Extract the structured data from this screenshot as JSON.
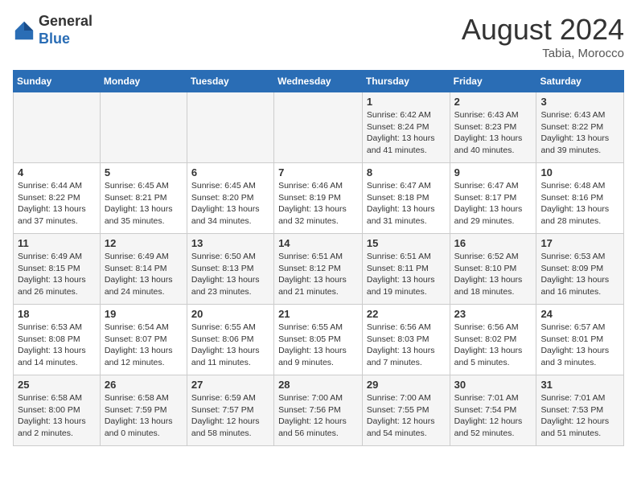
{
  "header": {
    "logo_line1": "General",
    "logo_line2": "Blue",
    "month_year": "August 2024",
    "location": "Tabia, Morocco"
  },
  "weekdays": [
    "Sunday",
    "Monday",
    "Tuesday",
    "Wednesday",
    "Thursday",
    "Friday",
    "Saturday"
  ],
  "weeks": [
    [
      {
        "day": "",
        "info": ""
      },
      {
        "day": "",
        "info": ""
      },
      {
        "day": "",
        "info": ""
      },
      {
        "day": "",
        "info": ""
      },
      {
        "day": "1",
        "info": "Sunrise: 6:42 AM\nSunset: 8:24 PM\nDaylight: 13 hours\nand 41 minutes."
      },
      {
        "day": "2",
        "info": "Sunrise: 6:43 AM\nSunset: 8:23 PM\nDaylight: 13 hours\nand 40 minutes."
      },
      {
        "day": "3",
        "info": "Sunrise: 6:43 AM\nSunset: 8:22 PM\nDaylight: 13 hours\nand 39 minutes."
      }
    ],
    [
      {
        "day": "4",
        "info": "Sunrise: 6:44 AM\nSunset: 8:22 PM\nDaylight: 13 hours\nand 37 minutes."
      },
      {
        "day": "5",
        "info": "Sunrise: 6:45 AM\nSunset: 8:21 PM\nDaylight: 13 hours\nand 35 minutes."
      },
      {
        "day": "6",
        "info": "Sunrise: 6:45 AM\nSunset: 8:20 PM\nDaylight: 13 hours\nand 34 minutes."
      },
      {
        "day": "7",
        "info": "Sunrise: 6:46 AM\nSunset: 8:19 PM\nDaylight: 13 hours\nand 32 minutes."
      },
      {
        "day": "8",
        "info": "Sunrise: 6:47 AM\nSunset: 8:18 PM\nDaylight: 13 hours\nand 31 minutes."
      },
      {
        "day": "9",
        "info": "Sunrise: 6:47 AM\nSunset: 8:17 PM\nDaylight: 13 hours\nand 29 minutes."
      },
      {
        "day": "10",
        "info": "Sunrise: 6:48 AM\nSunset: 8:16 PM\nDaylight: 13 hours\nand 28 minutes."
      }
    ],
    [
      {
        "day": "11",
        "info": "Sunrise: 6:49 AM\nSunset: 8:15 PM\nDaylight: 13 hours\nand 26 minutes."
      },
      {
        "day": "12",
        "info": "Sunrise: 6:49 AM\nSunset: 8:14 PM\nDaylight: 13 hours\nand 24 minutes."
      },
      {
        "day": "13",
        "info": "Sunrise: 6:50 AM\nSunset: 8:13 PM\nDaylight: 13 hours\nand 23 minutes."
      },
      {
        "day": "14",
        "info": "Sunrise: 6:51 AM\nSunset: 8:12 PM\nDaylight: 13 hours\nand 21 minutes."
      },
      {
        "day": "15",
        "info": "Sunrise: 6:51 AM\nSunset: 8:11 PM\nDaylight: 13 hours\nand 19 minutes."
      },
      {
        "day": "16",
        "info": "Sunrise: 6:52 AM\nSunset: 8:10 PM\nDaylight: 13 hours\nand 18 minutes."
      },
      {
        "day": "17",
        "info": "Sunrise: 6:53 AM\nSunset: 8:09 PM\nDaylight: 13 hours\nand 16 minutes."
      }
    ],
    [
      {
        "day": "18",
        "info": "Sunrise: 6:53 AM\nSunset: 8:08 PM\nDaylight: 13 hours\nand 14 minutes."
      },
      {
        "day": "19",
        "info": "Sunrise: 6:54 AM\nSunset: 8:07 PM\nDaylight: 13 hours\nand 12 minutes."
      },
      {
        "day": "20",
        "info": "Sunrise: 6:55 AM\nSunset: 8:06 PM\nDaylight: 13 hours\nand 11 minutes."
      },
      {
        "day": "21",
        "info": "Sunrise: 6:55 AM\nSunset: 8:05 PM\nDaylight: 13 hours\nand 9 minutes."
      },
      {
        "day": "22",
        "info": "Sunrise: 6:56 AM\nSunset: 8:03 PM\nDaylight: 13 hours\nand 7 minutes."
      },
      {
        "day": "23",
        "info": "Sunrise: 6:56 AM\nSunset: 8:02 PM\nDaylight: 13 hours\nand 5 minutes."
      },
      {
        "day": "24",
        "info": "Sunrise: 6:57 AM\nSunset: 8:01 PM\nDaylight: 13 hours\nand 3 minutes."
      }
    ],
    [
      {
        "day": "25",
        "info": "Sunrise: 6:58 AM\nSunset: 8:00 PM\nDaylight: 13 hours\nand 2 minutes."
      },
      {
        "day": "26",
        "info": "Sunrise: 6:58 AM\nSunset: 7:59 PM\nDaylight: 13 hours\nand 0 minutes."
      },
      {
        "day": "27",
        "info": "Sunrise: 6:59 AM\nSunset: 7:57 PM\nDaylight: 12 hours\nand 58 minutes."
      },
      {
        "day": "28",
        "info": "Sunrise: 7:00 AM\nSunset: 7:56 PM\nDaylight: 12 hours\nand 56 minutes."
      },
      {
        "day": "29",
        "info": "Sunrise: 7:00 AM\nSunset: 7:55 PM\nDaylight: 12 hours\nand 54 minutes."
      },
      {
        "day": "30",
        "info": "Sunrise: 7:01 AM\nSunset: 7:54 PM\nDaylight: 12 hours\nand 52 minutes."
      },
      {
        "day": "31",
        "info": "Sunrise: 7:01 AM\nSunset: 7:53 PM\nDaylight: 12 hours\nand 51 minutes."
      }
    ]
  ]
}
